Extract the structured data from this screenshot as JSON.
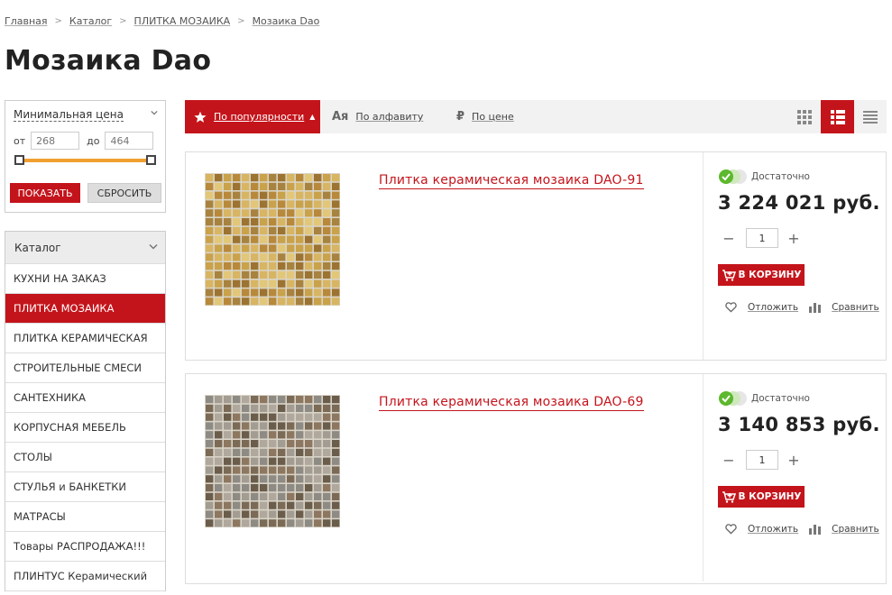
{
  "breadcrumb": [
    "Главная",
    "Каталог",
    "ПЛИТКА МОЗАИКА",
    "Мозаика Dao"
  ],
  "breadcrumb_sep": ">",
  "title": "Мозаика Dao",
  "filter": {
    "title": "Минимальная цена",
    "from_label": "от",
    "to_label": "до",
    "from_placeholder": "268",
    "to_placeholder": "464",
    "show_label": "ПОКАЗАТЬ",
    "reset_label": "СБРОСИТЬ",
    "slider_color": "#f0a030"
  },
  "catalog": {
    "title": "Каталог",
    "items": [
      "КУХНИ НА ЗАКАЗ",
      "ПЛИТКА МОЗАИКА",
      "ПЛИТКА КЕРАМИЧЕСКАЯ",
      "СТРОИТЕЛЬНЫЕ СМЕСИ",
      "САНТЕХНИКА",
      "КОРПУСНАЯ МЕБЕЛЬ",
      "СТОЛЫ",
      "СТУЛЬЯ и БАНКЕТКИ",
      "МАТРАСЫ",
      "Товары РАСПРОДАЖА!!!",
      "ПЛИНТУС Керамический"
    ],
    "active_index": 1
  },
  "sort": {
    "popularity": "По популярности",
    "alpha": "По алфавиту",
    "alpha_icon": "Ая",
    "price": "По цене",
    "price_icon": "₽"
  },
  "products": [
    {
      "name": "Плитка керамическая мозаика DAO-91",
      "stock": "Достаточно",
      "price": "3 224 021 руб.",
      "qty": "1",
      "cart_label": "В КОРЗИНУ",
      "defer_label": "Отложить",
      "compare_label": "Сравнить",
      "palette": [
        "#c9a24a",
        "#b8893a",
        "#d8b562",
        "#9c7330",
        "#e2c778",
        "#a8833f"
      ]
    },
    {
      "name": "Плитка керамическая мозаика DAO-69",
      "stock": "Достаточно",
      "price": "3 140 853 руб.",
      "qty": "1",
      "cart_label": "В КОРЗИНУ",
      "defer_label": "Отложить",
      "compare_label": "Сравнить",
      "palette": [
        "#8e8a84",
        "#7a6a56",
        "#a39c92",
        "#6b5d4b",
        "#b0a89c",
        "#8d7760"
      ]
    }
  ],
  "colors": {
    "accent": "#c4141b",
    "stock_ok": "#5cb82c"
  }
}
